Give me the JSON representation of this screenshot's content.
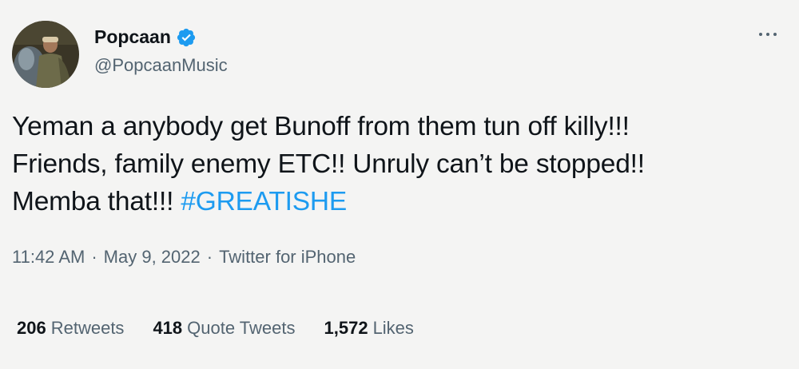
{
  "author": {
    "display_name": "Popcaan",
    "handle": "@PopcaanMusic",
    "verified": true
  },
  "tweet": {
    "lines": [
      "Yeman a anybody get Bunoff from them tun off killy!!!",
      "Friends, family enemy ETC!! Unruly can’t be stopped!!"
    ],
    "last_line_text": "Memba that!!!",
    "hashtag": "#GREATISHE"
  },
  "meta": {
    "time": "11:42 AM",
    "sep1": "·",
    "date": "May 9, 2022",
    "sep2": "·",
    "source": "Twitter for iPhone"
  },
  "stats": {
    "retweets_count": "206",
    "retweets_label": "Retweets",
    "quotes_count": "418",
    "quotes_label": "Quote Tweets",
    "likes_count": "1,572",
    "likes_label": "Likes"
  },
  "colors": {
    "accent": "#1d9bf0",
    "secondary_text": "#536471",
    "primary_text": "#0f1419"
  }
}
